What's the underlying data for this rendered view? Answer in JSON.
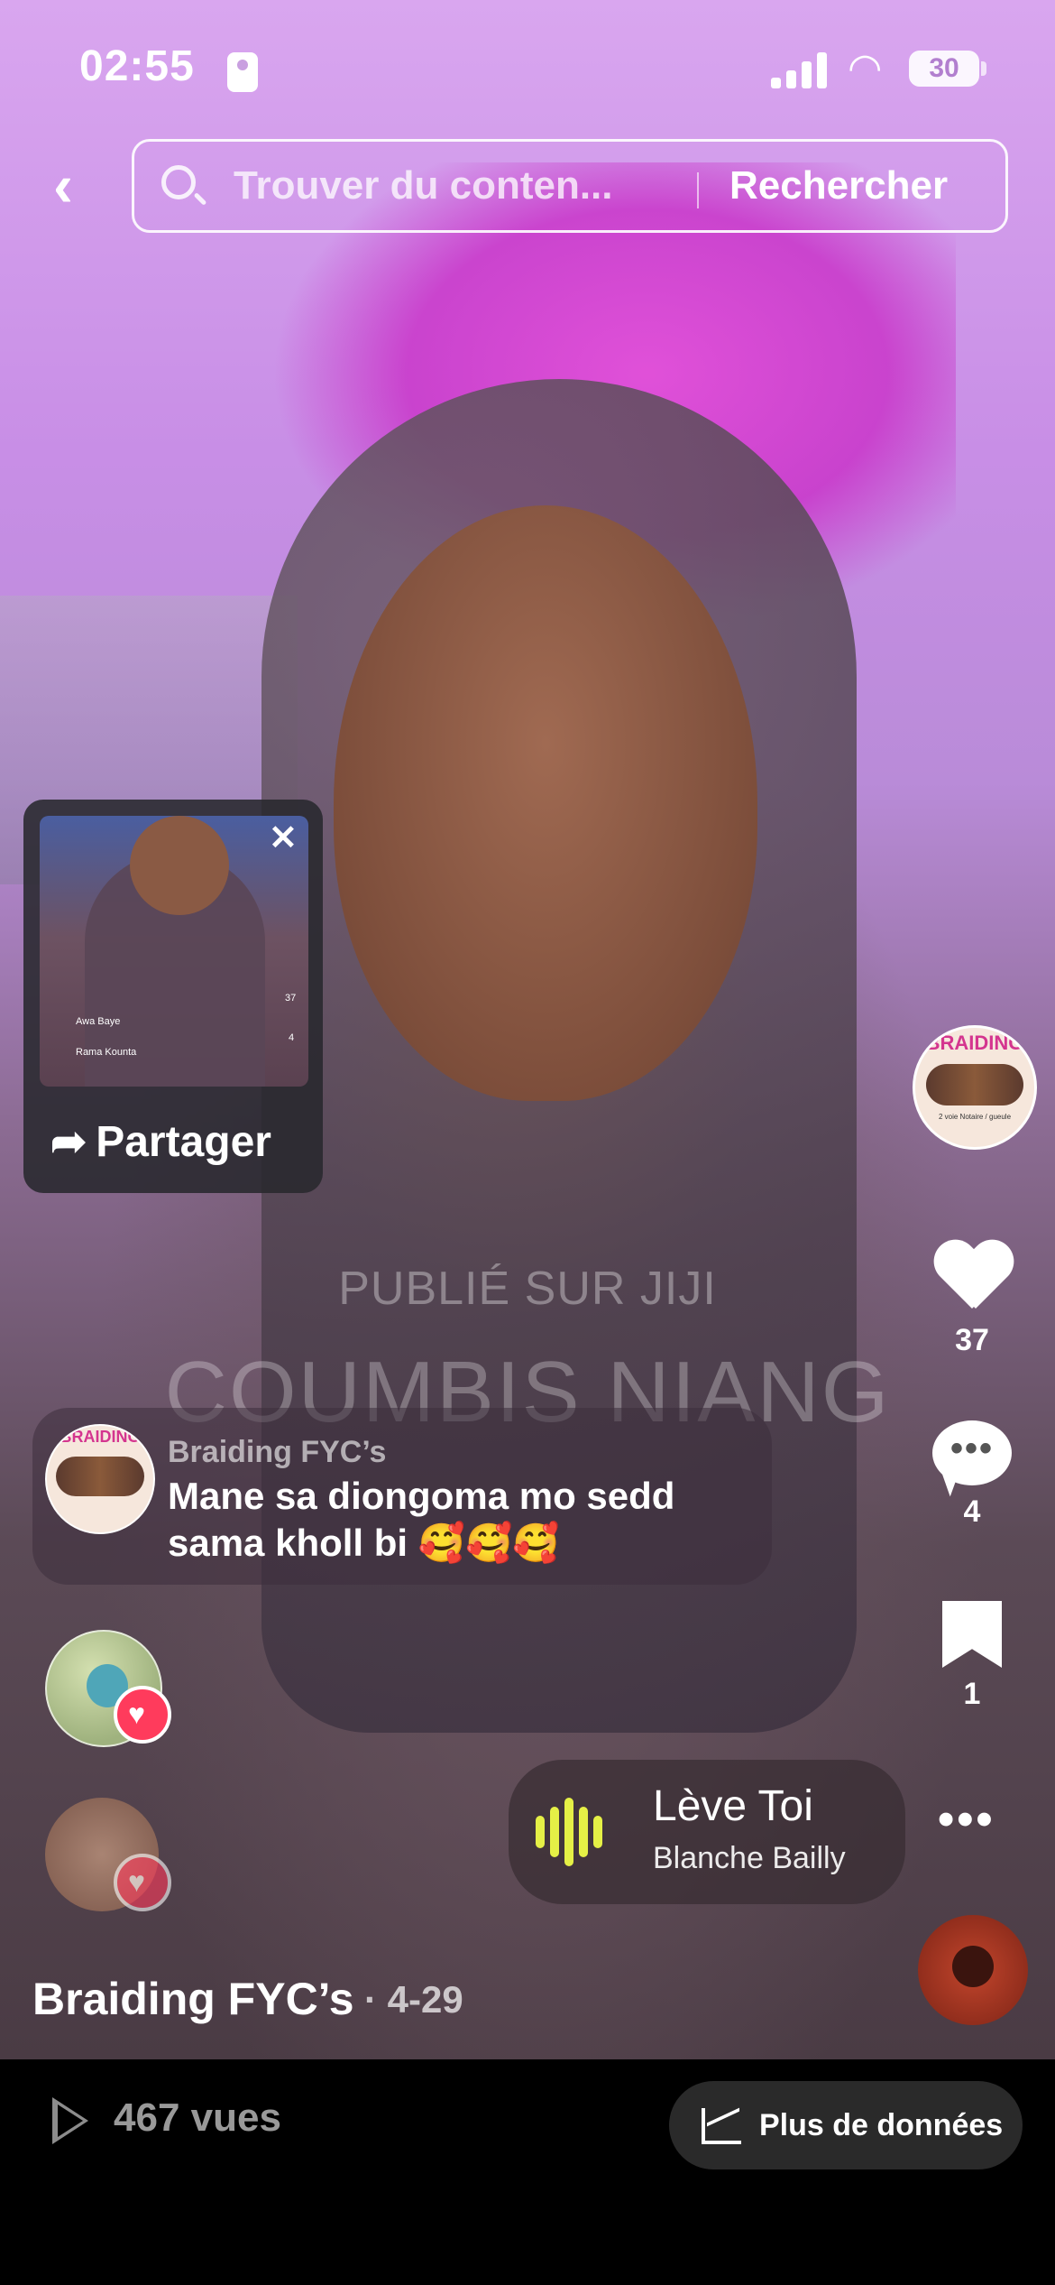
{
  "status_bar": {
    "time": "02:55",
    "battery": "30"
  },
  "search": {
    "back_icon": "chevron-left-icon",
    "placeholder": "Trouver du conten...",
    "button": "Rechercher"
  },
  "share_card": {
    "button_label": "Partager",
    "close_icon": "close-icon",
    "thumb_comments": [
      "Awa Baye",
      "Rama Kounta"
    ],
    "thumb_likes": "37",
    "thumb_comment_count": "4"
  },
  "watermark": {
    "line1": "PUBLIÉ SUR JIJI",
    "line2": "COUMBIS NIANG"
  },
  "creator_avatar": {
    "logo_text": "BRAIDING",
    "small_text": "2 voie Notaire / gueule"
  },
  "actions": {
    "likes": "37",
    "comments": "4",
    "saves": "1"
  },
  "comment": {
    "author": "Braiding FYC’s",
    "text": "Mane sa diongoma mo sedd sama kholl bi 🥰🥰🥰",
    "avatar_logo": "BRAIDING"
  },
  "music": {
    "title": "Lève Toi",
    "artist": "Blanche Bailly"
  },
  "post": {
    "author": "Braiding FYC’s",
    "date": "· 4-29"
  },
  "bottom": {
    "views": "467 vues",
    "more_data": "Plus de données"
  },
  "colors": {
    "like_red": "#ff3b5c",
    "music_bars": "#e5f046",
    "background_top": "#d9a6ef"
  }
}
